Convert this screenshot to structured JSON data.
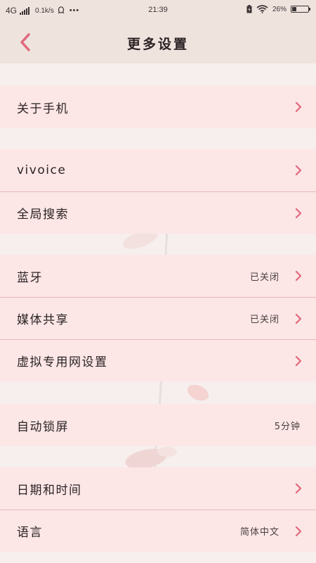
{
  "status_bar": {
    "network": "4G",
    "speed": "0.1k/s",
    "more": "•••",
    "time": "21:39",
    "battery_percent": "26%",
    "battery_level": 0.26,
    "icons": [
      "signal-icon",
      "qq-icon",
      "battery-charging-icon",
      "wifi-icon",
      "battery-icon"
    ]
  },
  "header": {
    "back_icon": "chevron-left-icon",
    "title": "更多设置"
  },
  "groups": [
    {
      "items": [
        {
          "label": "关于手机",
          "value": "",
          "arrow": true
        }
      ]
    },
    {
      "items": [
        {
          "label": "vivoice",
          "value": "",
          "arrow": true
        },
        {
          "label": "全局搜索",
          "value": "",
          "arrow": true
        }
      ]
    },
    {
      "items": [
        {
          "label": "蓝牙",
          "value": "已关闭",
          "arrow": true
        },
        {
          "label": "媒体共享",
          "value": "已关闭",
          "arrow": true
        },
        {
          "label": "虚拟专用网设置",
          "value": "",
          "arrow": true
        }
      ]
    },
    {
      "items": [
        {
          "label": "自动锁屏",
          "value": "5分钟",
          "arrow": false
        }
      ]
    },
    {
      "items": [
        {
          "label": "日期和时间",
          "value": "",
          "arrow": true
        },
        {
          "label": "语言",
          "value": "简体中文",
          "arrow": true
        }
      ]
    }
  ],
  "colors": {
    "accent": "#e0687c",
    "row_background": "#fce6e6",
    "divider": "#e9b7bb",
    "header_background": "#efe3de"
  }
}
